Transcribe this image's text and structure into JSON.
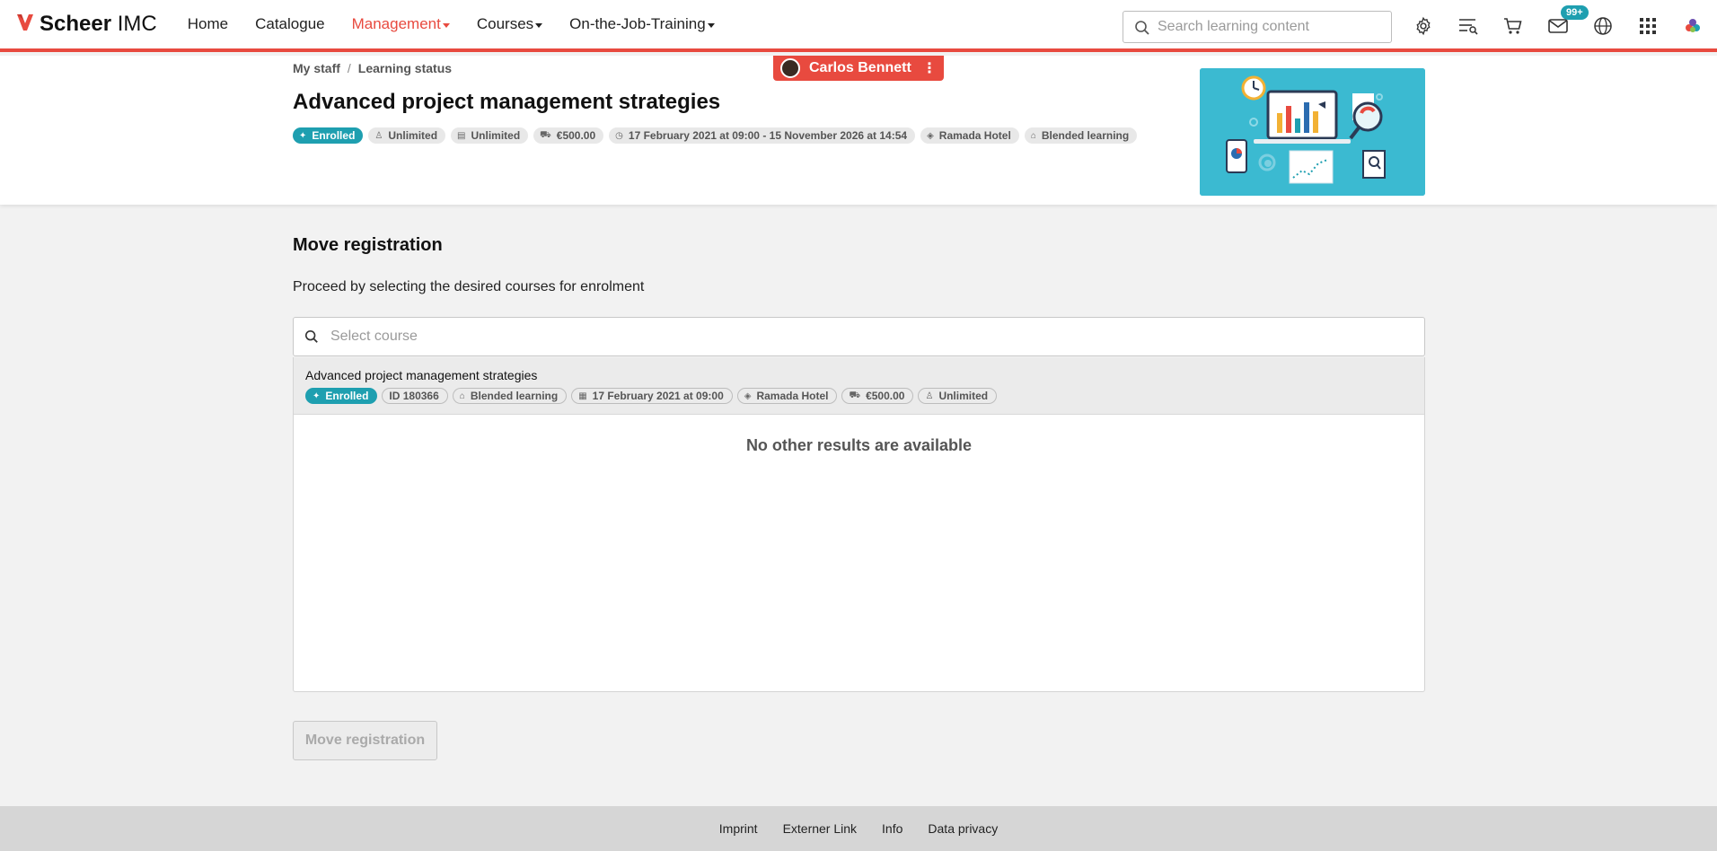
{
  "brand": {
    "name_bold": "Scheer",
    "name_rest": "IMC",
    "accent": "#e84a3f",
    "teal": "#1e9fb0"
  },
  "nav": {
    "items": [
      {
        "label": "Home",
        "active": false,
        "dropdown": false
      },
      {
        "label": "Catalogue",
        "active": false,
        "dropdown": false
      },
      {
        "label": "Management",
        "active": true,
        "dropdown": true
      },
      {
        "label": "Courses",
        "active": false,
        "dropdown": true
      },
      {
        "label": "On-the-Job-Training",
        "active": false,
        "dropdown": true
      }
    ]
  },
  "search": {
    "placeholder": "Search learning content"
  },
  "toolbar": {
    "icons": [
      "gear-icon",
      "playlist-search-icon",
      "cart-icon",
      "mail-icon",
      "globe-icon",
      "apps-grid-icon",
      "brand-logo-icon"
    ],
    "mail_badge": "99+"
  },
  "breadcrumb": {
    "items": [
      "My staff",
      "Learning status"
    ],
    "separator": "/"
  },
  "user": {
    "name": "Carlos Bennett"
  },
  "course": {
    "title": "Advanced project management strategies",
    "tags": [
      {
        "label": "Enrolled",
        "icon": "enrolled-icon"
      },
      {
        "label": "Unlimited",
        "icon": "seat-icon"
      },
      {
        "label": "Unlimited",
        "icon": "waitlist-icon"
      },
      {
        "label": "€500.00",
        "icon": "cart-icon"
      },
      {
        "label": "17 February 2021 at 09:00 - 15 November 2026 at 14:54",
        "icon": "clock-icon"
      },
      {
        "label": "Ramada Hotel",
        "icon": "location-icon"
      },
      {
        "label": "Blended learning",
        "icon": "course-type-icon"
      }
    ]
  },
  "main": {
    "title": "Move registration",
    "subtitle": "Proceed by selecting the desired courses for enrolment",
    "search_placeholder": "Select course",
    "result": {
      "title": "Advanced project management strategies",
      "tags": [
        {
          "label": "Enrolled",
          "icon": "enrolled-icon"
        },
        {
          "label": "ID 180366",
          "icon": ""
        },
        {
          "label": "Blended learning",
          "icon": "course-type-icon"
        },
        {
          "label": "17 February 2021 at 09:00",
          "icon": "calendar-icon"
        },
        {
          "label": "Ramada Hotel",
          "icon": "location-icon"
        },
        {
          "label": "€500.00",
          "icon": "cart-icon"
        },
        {
          "label": "Unlimited",
          "icon": "seat-icon"
        }
      ]
    },
    "no_results": "No other results are available",
    "button_label": "Move registration"
  },
  "footer": {
    "links": [
      "Imprint",
      "Externer Link",
      "Info",
      "Data privacy"
    ]
  }
}
